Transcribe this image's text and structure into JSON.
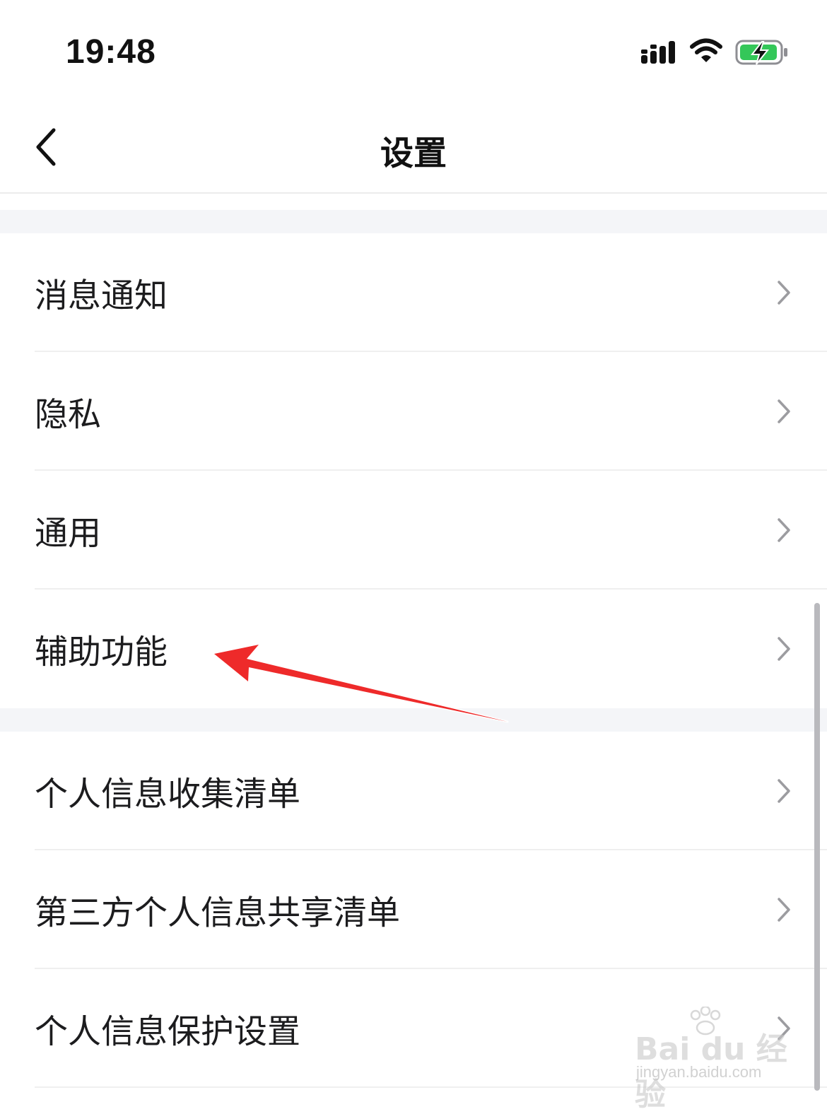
{
  "status_bar": {
    "time": "19:48",
    "signal_icon": "signal-bars-icon",
    "wifi_icon": "wifi-icon",
    "battery_icon": "battery-charging-icon",
    "battery_color": "#34c759"
  },
  "nav": {
    "back_icon": "chevron-left-icon",
    "title": "设置"
  },
  "groups": [
    {
      "items": [
        {
          "label": "消息通知"
        },
        {
          "label": "隐私"
        },
        {
          "label": "通用"
        },
        {
          "label": "辅助功能"
        }
      ]
    },
    {
      "items": [
        {
          "label": "个人信息收集清单"
        },
        {
          "label": "第三方个人信息共享清单"
        },
        {
          "label": "个人信息保护设置"
        }
      ]
    }
  ],
  "annotation": {
    "arrow_color": "#ee2a2a",
    "points_to": "辅助功能"
  },
  "watermark": {
    "logo": "Bai du 经验",
    "url": "jingyan.baidu.com"
  },
  "colors": {
    "section_gap": "#f4f5f8",
    "chevron": "#9c9ca0",
    "text": "#1c1c1e"
  }
}
